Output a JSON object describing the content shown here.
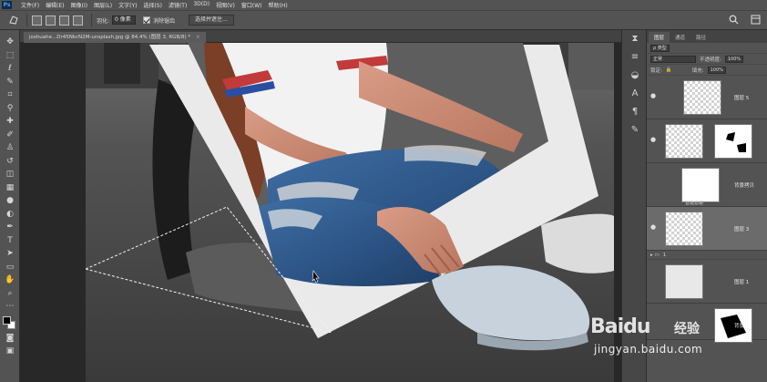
{
  "menubar": {
    "logo": "Ps",
    "items": [
      "文件(F)",
      "编辑(E)",
      "图像(I)",
      "图层(L)",
      "文字(Y)",
      "选择(S)",
      "滤镜(T)",
      "3D(D)",
      "视图(V)",
      "窗口(W)",
      "帮助(H)"
    ]
  },
  "options": {
    "feather_label": "羽化:",
    "feather_value": "0 像素",
    "antialias_label": "消除锯齿",
    "select_mask_label": "选择并遮住..."
  },
  "document": {
    "tab_title": "joshuahe...Dr45NkcN2M-unsplash.jpg @ 84.4% (图层 3, RGB/8) *",
    "close": "×"
  },
  "panel": {
    "tabs": [
      "图层",
      "通道",
      "路径"
    ],
    "kind_label": "ρ 类型",
    "blend_mode": "正常",
    "opacity_label": "不透明度:",
    "opacity_value": "100%",
    "lock_label": "锁定:",
    "fill_label": "填充:",
    "fill_value": "100%",
    "layers": [
      {
        "name": "图层 5"
      },
      {
        "name": ""
      },
      {
        "name": "背景拷贝"
      },
      {
        "name": "图层 3"
      },
      {
        "name": "图层 1"
      },
      {
        "name": "背景"
      }
    ],
    "smart_filters_label": "智能滤镜",
    "group_name": "1",
    "eye": "●"
  },
  "watermark": {
    "brand": "Baidu",
    "brand2": "经验",
    "url": "jingyan.baidu.com"
  },
  "icons": [
    "move-icon",
    "marquee-icon",
    "lasso-icon",
    "quick-select-icon",
    "crop-icon",
    "eyedropper-icon",
    "healing-icon",
    "brush-icon",
    "stamp-icon",
    "history-brush-icon",
    "eraser-icon",
    "gradient-icon",
    "blur-icon",
    "dodge-icon",
    "pen-icon",
    "type-icon",
    "path-select-icon",
    "shape-icon",
    "hand-icon",
    "zoom-icon"
  ]
}
